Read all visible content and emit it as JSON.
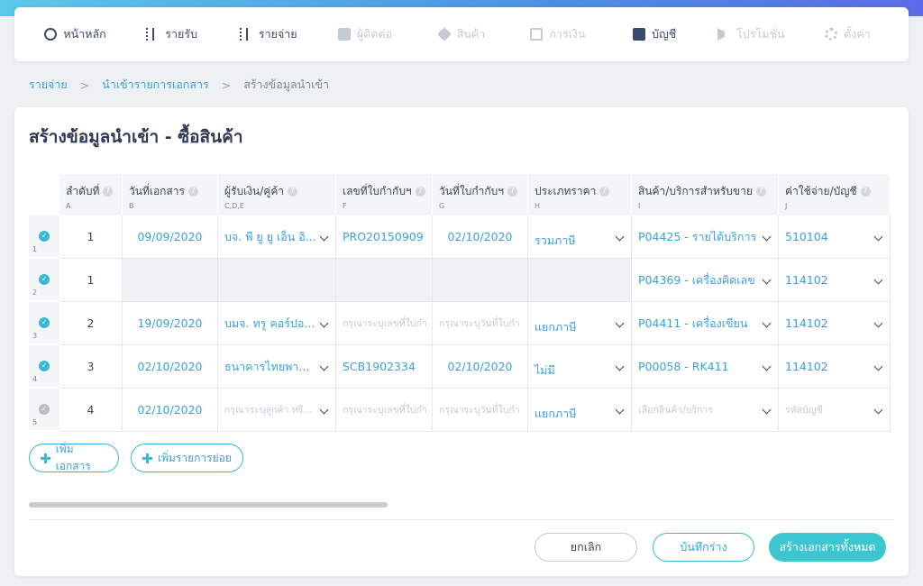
{
  "nav": {
    "items": [
      {
        "label": "หน้าหลัก",
        "icon": "home-dashboard-icon",
        "disabled": false
      },
      {
        "label": "รายรับ",
        "icon": "income-bars-icon",
        "disabled": false
      },
      {
        "label": "รายจ่าย",
        "icon": "expense-bars-icon",
        "disabled": false
      },
      {
        "label": "ผู้ติดต่อ",
        "icon": "contact-icon",
        "disabled": true
      },
      {
        "label": "สินค้า",
        "icon": "product-box-icon",
        "disabled": true
      },
      {
        "label": "การเงิน",
        "icon": "money-icon",
        "disabled": true
      },
      {
        "label": "บัญชี",
        "icon": "accounting-book-icon",
        "disabled": false
      },
      {
        "label": "โปรโมชั่น",
        "icon": "megaphone-icon",
        "disabled": true
      },
      {
        "label": "ตั้งค่า",
        "icon": "gear-icon",
        "disabled": true
      }
    ]
  },
  "breadcrumb": {
    "items": [
      "รายจ่าย",
      "นำเข้ารายการเอกสาร",
      "สร้างข้อมูลนำเข้า"
    ],
    "sep": ">"
  },
  "page": {
    "title": "สร้างข้อมูลนำเข้า - ซื้อสินค้า"
  },
  "table": {
    "columns": [
      {
        "label": "ลำดับที่",
        "sub": "A"
      },
      {
        "label": "วันที่เอกสาร",
        "sub": "B"
      },
      {
        "label": "ผู้รับเงิน/คู่ค้า",
        "sub": "C,D,E"
      },
      {
        "label": "เลขที่ใบกำกับฯ",
        "sub": "F"
      },
      {
        "label": "วันที่ใบกำกับฯ",
        "sub": "G"
      },
      {
        "label": "ประเภทราคา",
        "sub": "H"
      },
      {
        "label": "สินค้า/บริการสำหรับขาย",
        "sub": "I"
      },
      {
        "label": "ค่าใช้จ่าย/บัญชี",
        "sub": "J"
      }
    ],
    "rows": [
      {
        "num": "1",
        "status": "valid",
        "seq": "1",
        "doc_date": "09/09/2020",
        "payee": "บจ. พี ยู ยู เอ็น อิ...",
        "invoice_no": "PRO20150909",
        "invoice_date": "02/10/2020",
        "price_type": "รวมภาษี",
        "product": "P04425 - รายได้บริการ",
        "account": "510104"
      },
      {
        "num": "2",
        "status": "valid",
        "seq": "1",
        "doc_date": "",
        "payee": "",
        "invoice_no": "",
        "invoice_date": "",
        "price_type": "",
        "product": "P04369 - เครื่องคิดเลข",
        "account": "114102"
      },
      {
        "num": "3",
        "status": "valid",
        "seq": "2",
        "doc_date": "19/09/2020",
        "payee": "บมจ. ทรู คอร์ปอ...",
        "invoice_no": "กรุณาระบุเลขที่ใบกำ",
        "invoice_date": "กรุณาระบุวันที่ใบกำ",
        "price_type": "แยกภาษี",
        "product": "P04411 - เครื่องเขียน",
        "account": "114102"
      },
      {
        "num": "4",
        "status": "valid",
        "seq": "3",
        "doc_date": "02/10/2020",
        "payee": "ธนาคารไทยพา...",
        "invoice_no": "SCB1902334",
        "invoice_date": "02/10/2020",
        "price_type": "ไม่มี",
        "product": "P00058 - RK411",
        "account": "114102"
      },
      {
        "num": "5",
        "status": "pending",
        "seq": "4",
        "doc_date": "02/10/2020",
        "payee": "กรุณาระบุลูกค้า หรื...",
        "invoice_no": "กรุณาระบุเลขที่ใบกำ",
        "invoice_date": "กรุณาระบุวันที่ใบกำ",
        "price_type": "แยกภาษี",
        "product": "เลือกสินค้า/บริการ",
        "account": "รหัสบัญชี"
      }
    ]
  },
  "actions": {
    "add_document": "เพิ่มเอกสาร",
    "add_line_item": "เพิ่มรายการย่อย"
  },
  "footer": {
    "cancel": "ยกเลิก",
    "save_draft": "บันทึกร่าง",
    "create_all": "สร้างเอกสารทั้งหมด"
  },
  "colors": {
    "accent": "#3ab9d3",
    "link": "#3aa0e0",
    "primary_button": "#3cc6d0"
  }
}
